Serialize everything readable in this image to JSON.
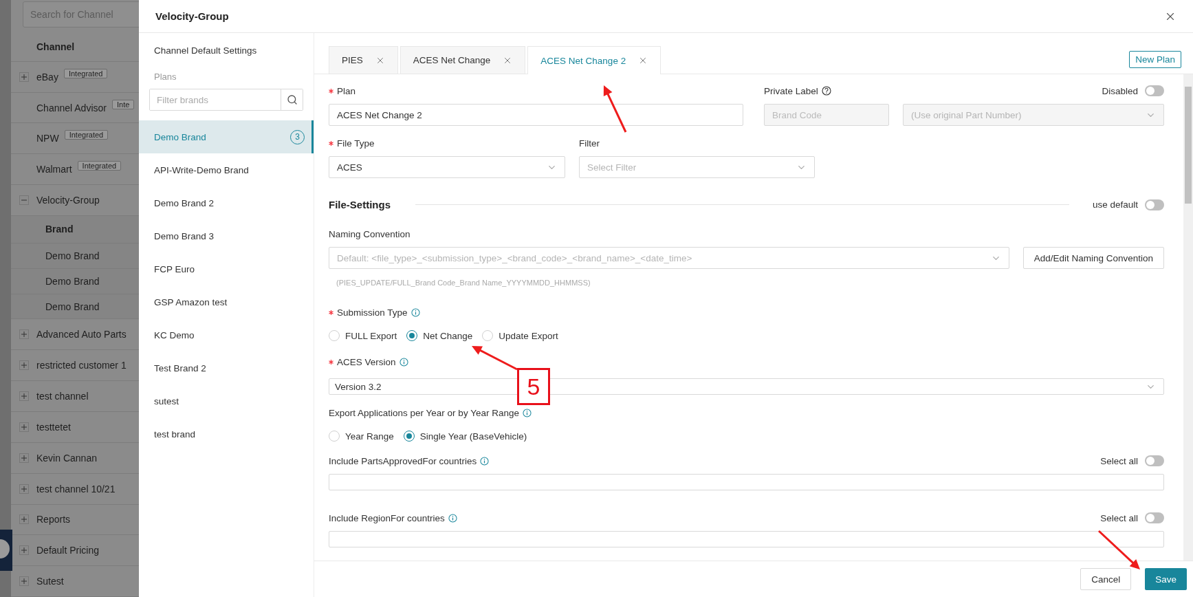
{
  "background_list": {
    "search_placeholder": "Search for Channel",
    "header": "Channel",
    "items": [
      {
        "label": "eBay",
        "expanded": false,
        "badge": "Integrated"
      },
      {
        "label": "Channel Advisor",
        "badge": "Inte"
      },
      {
        "label": "NPW",
        "badge": "Integrated"
      },
      {
        "label": "Walmart",
        "badge": "Integrated"
      },
      {
        "label": "Velocity-Group",
        "expanded": true,
        "sub_header": "Brand",
        "children": [
          {
            "label": "Demo Brand"
          },
          {
            "label": "Demo Brand"
          },
          {
            "label": "Demo Brand"
          }
        ]
      },
      {
        "label": "Advanced Auto Parts",
        "expanded": false
      },
      {
        "label": "restricted customer 1",
        "expanded": false
      },
      {
        "label": "test channel",
        "expanded": false
      },
      {
        "label": "testtetet",
        "expanded": false
      },
      {
        "label": "Kevin Cannan",
        "expanded": false
      },
      {
        "label": "test channel 10/21",
        "expanded": false
      },
      {
        "label": "Reports",
        "expanded": false
      },
      {
        "label": "Default Pricing",
        "expanded": false
      },
      {
        "label": "Sutest",
        "expanded": false
      }
    ]
  },
  "drawer": {
    "title": "Velocity-Group",
    "sidebar": {
      "default_settings": "Channel Default Settings",
      "plans_label": "Plans",
      "filter_placeholder": "Filter brands",
      "plans": [
        {
          "label": "Demo Brand",
          "selected": true,
          "count": "3"
        },
        {
          "label": "API-Write-Demo Brand",
          "selected": false
        },
        {
          "label": "Demo Brand 2",
          "selected": false
        },
        {
          "label": "Demo Brand 3",
          "selected": false
        },
        {
          "label": "FCP Euro",
          "selected": false
        },
        {
          "label": "GSP Amazon test",
          "selected": false
        },
        {
          "label": "KC Demo",
          "selected": false
        },
        {
          "label": "Test Brand 2",
          "selected": false
        },
        {
          "label": "sutest",
          "selected": false
        },
        {
          "label": "test brand",
          "selected": false
        }
      ]
    },
    "tabs": [
      {
        "label": "PIES",
        "selected": false
      },
      {
        "label": "ACES Net Change",
        "selected": false
      },
      {
        "label": "ACES Net Change 2",
        "selected": true
      }
    ],
    "new_plan": "New Plan",
    "form": {
      "plan": {
        "label": "Plan",
        "required": true,
        "value": "ACES Net Change 2"
      },
      "private_label": {
        "label": "Private Label",
        "brand_code_placeholder": "Brand Code",
        "part_number_placeholder": "(Use original Part Number)"
      },
      "disabled_toggle": {
        "label": "Disabled",
        "on": false
      },
      "file_type": {
        "label": "File Type",
        "required": true,
        "value": "ACES"
      },
      "filter": {
        "label": "Filter",
        "placeholder": "Select Filter"
      },
      "file_settings": {
        "title": "File-Settings",
        "use_default_label": "use default",
        "use_default_on": false
      },
      "naming_convention": {
        "label": "Naming Convention",
        "placeholder": "Default: <file_type>_<submission_type>_<brand_code>_<brand_name>_<date_time>",
        "button": "Add/Edit Naming Convention",
        "hint": "(PIES_UPDATE/FULL_Brand Code_Brand Name_YYYYMMDD_HHMMSS)"
      },
      "submission_type": {
        "label": "Submission Type",
        "required": true,
        "options": [
          {
            "label": "FULL Export",
            "selected": false
          },
          {
            "label": "Net Change",
            "selected": true
          },
          {
            "label": "Update Export",
            "selected": false
          }
        ]
      },
      "aces_version": {
        "label": "ACES Version",
        "required": true,
        "value": "Version 3.2"
      },
      "export_applications": {
        "label": "Export Applications per Year or by Year Range",
        "options": [
          {
            "label": "Year Range",
            "selected": false
          },
          {
            "label": "Single Year (BaseVehicle)",
            "selected": true
          }
        ]
      },
      "countries": [
        {
          "label": "Include PartsApprovedFor countries",
          "select_all": "Select all",
          "on": false
        },
        {
          "label": "Include RegionFor countries",
          "select_all": "Select all",
          "on": false
        }
      ]
    },
    "footer": {
      "cancel": "Cancel",
      "save": "Save"
    }
  },
  "annotations": [
    {
      "text": "5"
    }
  ]
}
